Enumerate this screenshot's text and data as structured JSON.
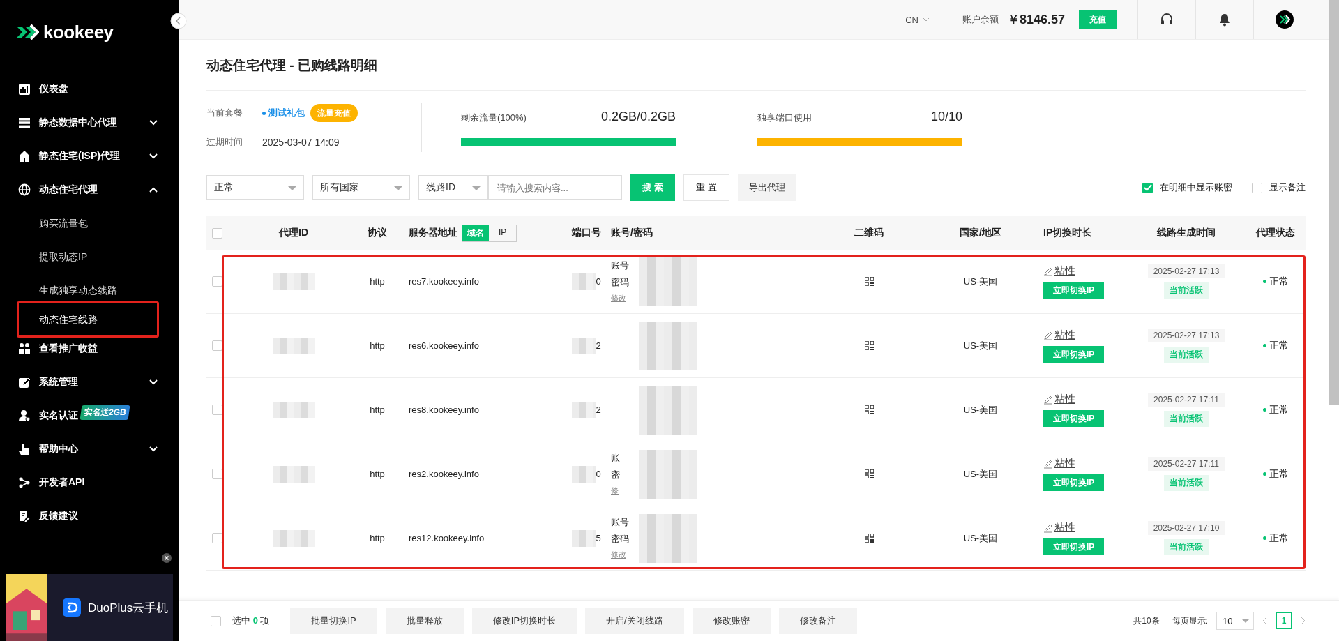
{
  "brand": {
    "name": "kookeey"
  },
  "sidebar": {
    "items": [
      {
        "label": "仪表盘"
      },
      {
        "label": "静态数据中心代理",
        "expanded": false
      },
      {
        "label": "静态住宅(ISP)代理",
        "expanded": false
      },
      {
        "label": "动态住宅代理",
        "expanded": true,
        "children": [
          {
            "label": "购买流量包",
            "selected": false,
            "annotated": false
          },
          {
            "label": "提取动态IP",
            "selected": false,
            "annotated": false
          },
          {
            "label": "生成独享动态线路",
            "selected": false,
            "annotated": false
          },
          {
            "label": "动态住宅线路",
            "selected": true,
            "annotated": true
          }
        ]
      },
      {
        "label": "查看推广收益"
      },
      {
        "label": "系统管理",
        "expanded": false
      },
      {
        "label": "实名认证",
        "badge": "实名送2GB"
      },
      {
        "label": "帮助中心",
        "expanded": false
      },
      {
        "label": "开发者API"
      },
      {
        "label": "反馈建议"
      }
    ],
    "ad": {
      "text": "DuoPlus云手机"
    }
  },
  "header": {
    "language": "CN",
    "balance_label": "账户余额",
    "balance": "￥8146.57",
    "recharge": "充值"
  },
  "page_title": "动态住宅代理 - 已购线路明细",
  "summary": {
    "plan_label": "当前套餐",
    "plan": "测试礼包",
    "plan_button": "流量充值",
    "expiry_label": "过期时间",
    "expiry": "2025-03-07 14:09",
    "meters": [
      {
        "label": "剩余流量(100%)",
        "reading": "0.2GB/0.2GB",
        "level": 1,
        "color": "#07c373"
      },
      {
        "label": "独享端口使用",
        "reading": "10/10",
        "level": 1,
        "color": "#fdb300"
      }
    ]
  },
  "filters": {
    "status": "正常",
    "country": "所有国家",
    "field": "线路ID",
    "search_placeholder": "请输入搜索内容...",
    "search": "搜 索",
    "reset": "重 置",
    "export": "导出代理",
    "options": [
      {
        "label": "在明细中显示账密",
        "checked": true
      },
      {
        "label": "显示备注",
        "checked": false
      }
    ]
  },
  "table": {
    "annotated": true,
    "select_all_checked": false,
    "columns": [
      "代理ID",
      "协议",
      "服务器地址",
      "端口号",
      "账号/密码",
      "二维码",
      "国家/地区",
      "IP切换时长",
      "线路生成时间",
      "代理状态"
    ],
    "address_toggle": [
      {
        "label": "域名",
        "selected": true
      },
      {
        "label": "IP",
        "selected": false
      }
    ],
    "rows": [
      {
        "protocol": "http",
        "server": "res7.kookeey.info",
        "port": "0",
        "account": [
          "账号",
          "密码",
          "修改"
        ],
        "country": "US-美国",
        "switch_mode": "粘性",
        "switch_button": "立即切换IP",
        "created": "2025-02-27 17:13",
        "activity": "当前活跃",
        "status": "正常",
        "checked": false
      },
      {
        "protocol": "http",
        "server": "res6.kookeey.info",
        "port": "2",
        "account": [],
        "country": "US-美国",
        "switch_mode": "粘性",
        "switch_button": "立即切换IP",
        "created": "2025-02-27 17:13",
        "activity": "当前活跃",
        "status": "正常",
        "checked": false
      },
      {
        "protocol": "http",
        "server": "res8.kookeey.info",
        "port": "2",
        "account": [],
        "country": "US-美国",
        "switch_mode": "粘性",
        "switch_button": "立即切换IP",
        "created": "2025-02-27 17:11",
        "activity": "当前活跃",
        "status": "正常",
        "checked": false
      },
      {
        "protocol": "http",
        "server": "res2.kookeey.info",
        "port": "0",
        "account": [
          "账",
          "密",
          "修"
        ],
        "country": "US-美国",
        "switch_mode": "粘性",
        "switch_button": "立即切换IP",
        "created": "2025-02-27 17:11",
        "activity": "当前活跃",
        "status": "正常",
        "checked": false
      },
      {
        "protocol": "http",
        "server": "res12.kookeey.info",
        "port": "5",
        "account": [
          "账号",
          "密码",
          "修改"
        ],
        "country": "US-美国",
        "switch_mode": "粘性",
        "switch_button": "立即切换IP",
        "created": "2025-02-27 17:10",
        "activity": "当前活跃",
        "status": "正常",
        "checked": false
      }
    ]
  },
  "footer": {
    "select_all_checked": false,
    "selected_prefix": "选中",
    "selected_count": "0",
    "selected_suffix": "项",
    "actions": [
      "批量切换IP",
      "批量释放",
      "修改IP切换时长",
      "开启/关闭线路",
      "修改账密",
      "修改备注"
    ],
    "total": "共10条",
    "page_size_label": "每页显示:",
    "page_size": "10",
    "pages": [
      {
        "label": "1",
        "selected": true
      }
    ]
  }
}
